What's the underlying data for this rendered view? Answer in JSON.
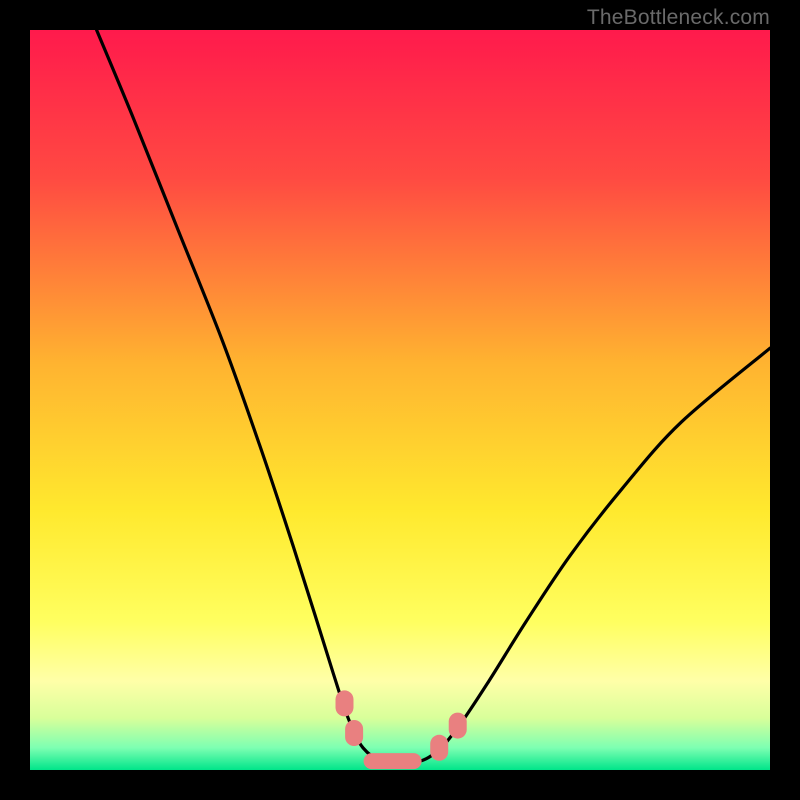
{
  "watermark": "TheBottleneck.com",
  "chart_data": {
    "type": "line",
    "title": "",
    "xlabel": "",
    "ylabel": "",
    "xlim": [
      0,
      100
    ],
    "ylim": [
      0,
      100
    ],
    "gradient_stops": [
      {
        "offset": 0,
        "color": "#ff1a4c"
      },
      {
        "offset": 20,
        "color": "#ff4a42"
      },
      {
        "offset": 45,
        "color": "#ffb330"
      },
      {
        "offset": 65,
        "color": "#ffe92e"
      },
      {
        "offset": 80,
        "color": "#ffff60"
      },
      {
        "offset": 88,
        "color": "#ffffa8"
      },
      {
        "offset": 93,
        "color": "#d8ff9a"
      },
      {
        "offset": 97,
        "color": "#7dffb2"
      },
      {
        "offset": 100,
        "color": "#00e58a"
      }
    ],
    "series": [
      {
        "name": "bottleneck-curve",
        "points": [
          {
            "x": 9,
            "y": 100
          },
          {
            "x": 14,
            "y": 88
          },
          {
            "x": 20,
            "y": 73
          },
          {
            "x": 26,
            "y": 58
          },
          {
            "x": 31,
            "y": 44
          },
          {
            "x": 35,
            "y": 32
          },
          {
            "x": 38.5,
            "y": 21
          },
          {
            "x": 41,
            "y": 13
          },
          {
            "x": 43,
            "y": 7
          },
          {
            "x": 45,
            "y": 3
          },
          {
            "x": 48,
            "y": 1
          },
          {
            "x": 52,
            "y": 1
          },
          {
            "x": 55,
            "y": 2.5
          },
          {
            "x": 58,
            "y": 6
          },
          {
            "x": 62,
            "y": 12
          },
          {
            "x": 67,
            "y": 20
          },
          {
            "x": 73,
            "y": 29
          },
          {
            "x": 80,
            "y": 38
          },
          {
            "x": 88,
            "y": 47
          },
          {
            "x": 100,
            "y": 57
          }
        ]
      }
    ],
    "markers": [
      {
        "x": 42.5,
        "y": 9,
        "shape": "round"
      },
      {
        "x": 43.8,
        "y": 5,
        "shape": "round"
      },
      {
        "x": 49,
        "y": 1.2,
        "shape": "wide"
      },
      {
        "x": 55.3,
        "y": 3,
        "shape": "round"
      },
      {
        "x": 57.8,
        "y": 6,
        "shape": "round"
      }
    ]
  }
}
